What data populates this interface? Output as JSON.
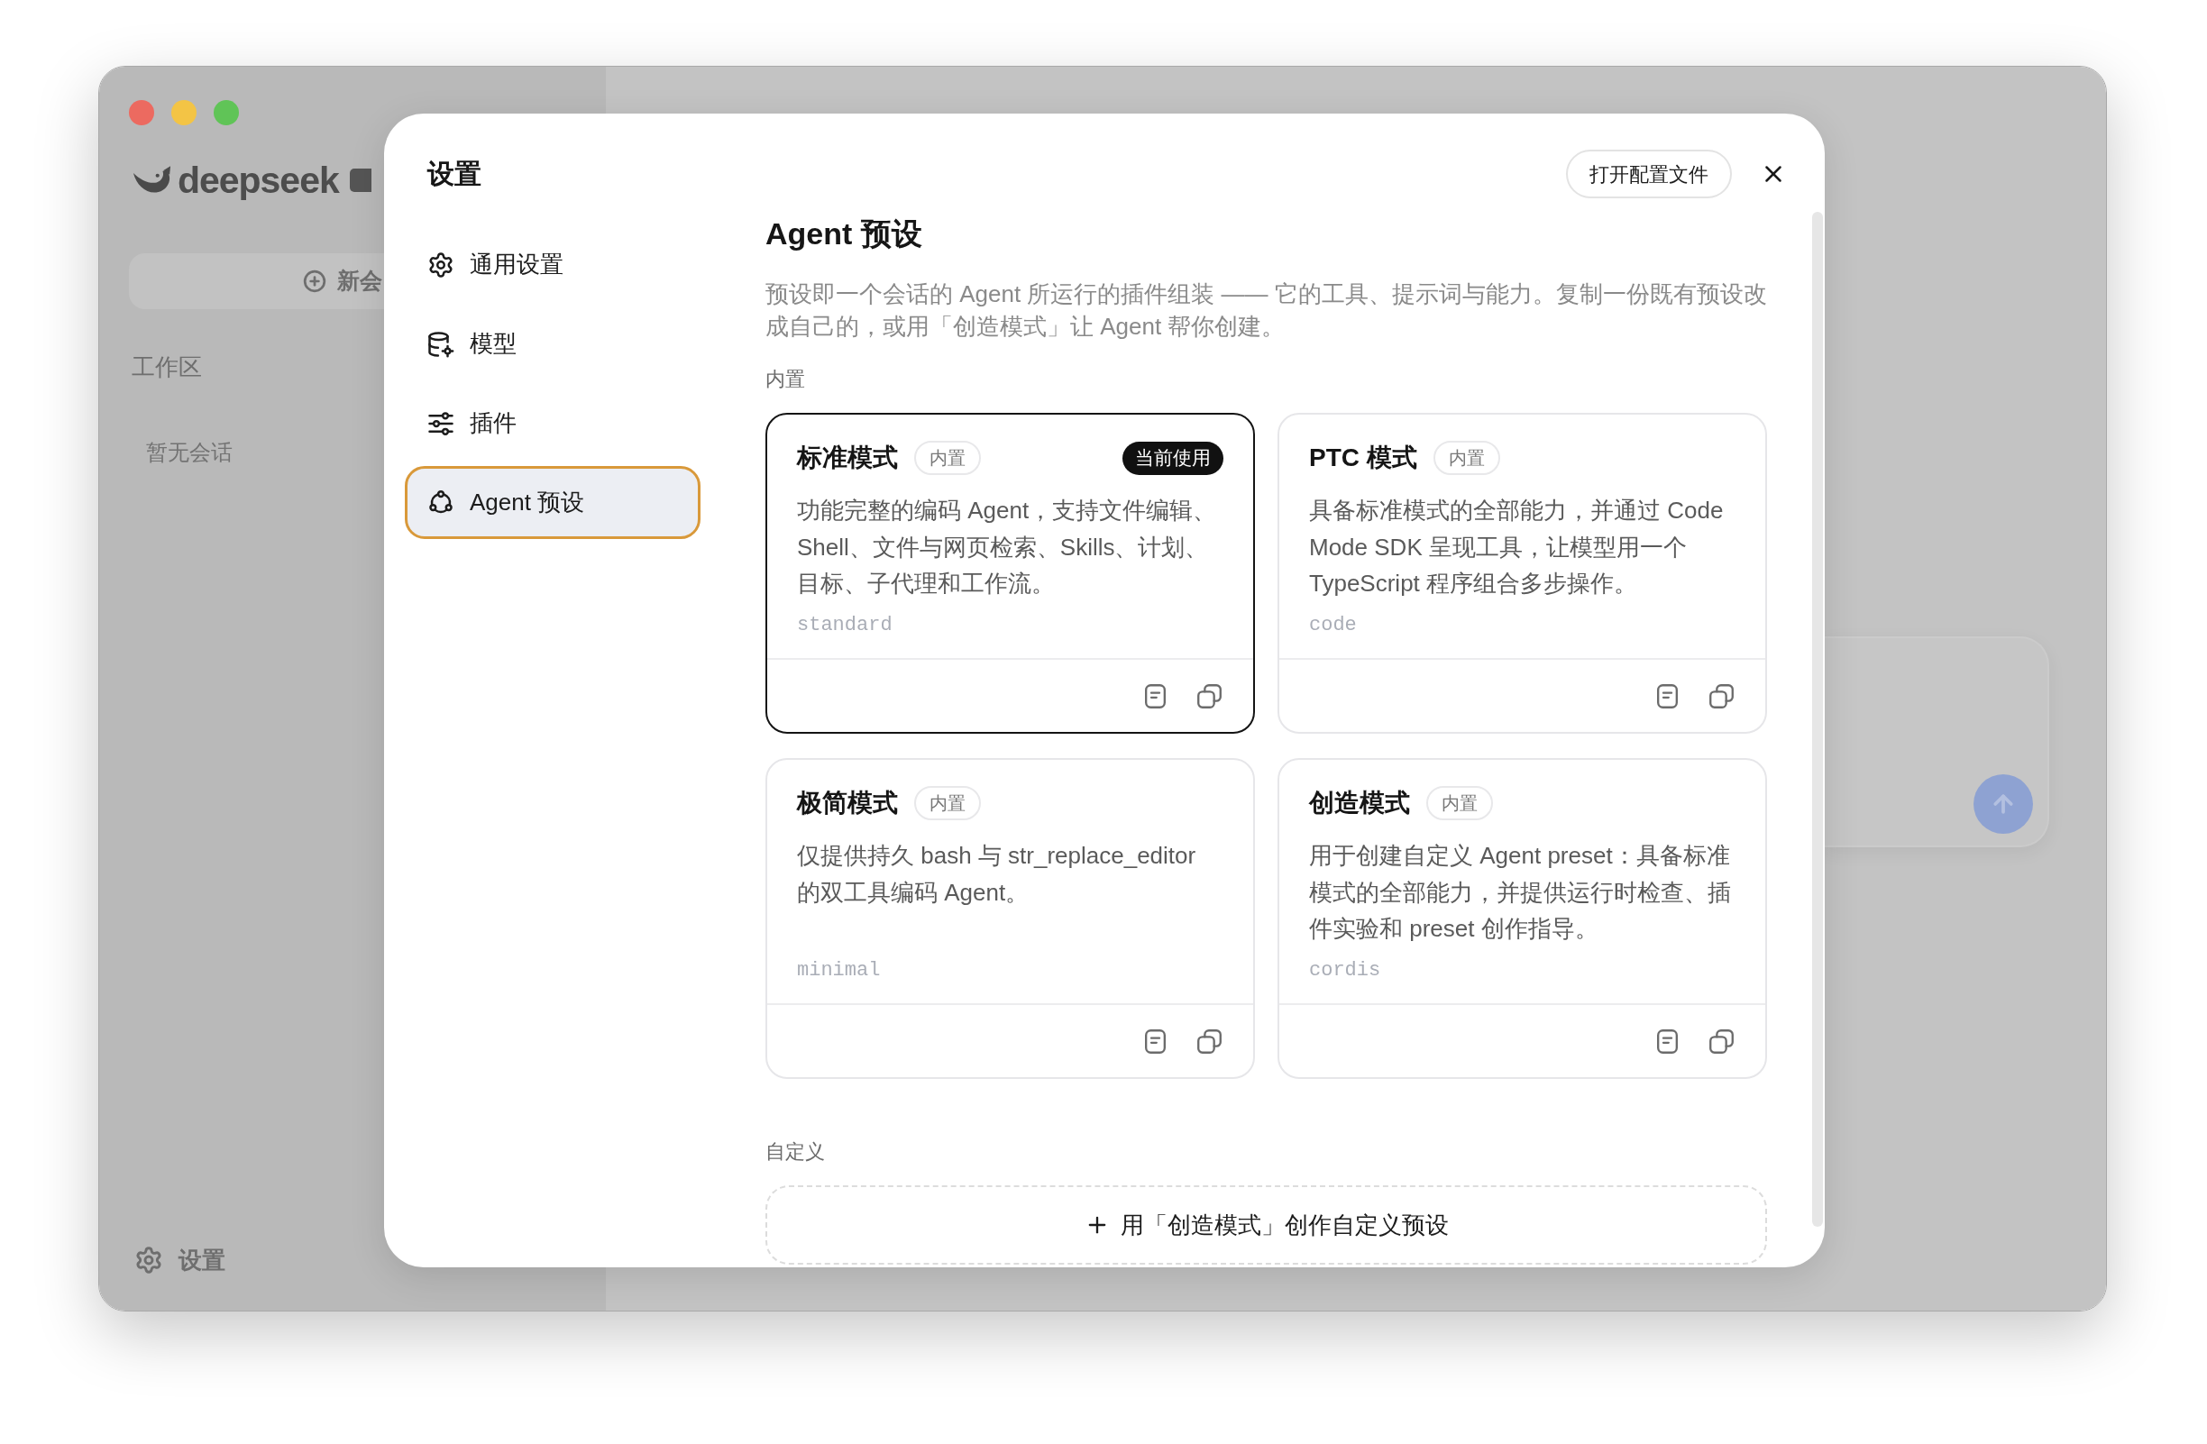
{
  "background_app": {
    "logo_text": "deepseek",
    "new_chat_button": "新会",
    "sidebar_section": "工作区",
    "empty_state": "暂无会话",
    "settings_button": "设置"
  },
  "settings_dialog": {
    "title": "设置",
    "nav_items": [
      {
        "label": "通用设置",
        "selected": false
      },
      {
        "label": "模型",
        "selected": false
      },
      {
        "label": "插件",
        "selected": false
      },
      {
        "label": "Agent 预设",
        "selected": true
      }
    ],
    "open_config_button": "打开配置文件",
    "page": {
      "title": "Agent 预设",
      "description": "预设即一个会话的 Agent 所运行的插件组装 —— 它的工具、提示词与能力。复制一份既有预设改成自己的，或用「创造模式」让 Agent 帮你创建。",
      "sections": [
        {
          "label": "内置",
          "cards": [
            {
              "title": "标准模式",
              "tag": "内置",
              "status": "当前使用",
              "selected": true,
              "description": "功能完整的编码 Agent，支持文件编辑、Shell、文件与网页检索、Skills、计划、目标、子代理和工作流。",
              "id": "standard"
            },
            {
              "title": "PTC 模式",
              "tag": "内置",
              "selected": false,
              "description": "具备标准模式的全部能力，并通过 Code Mode SDK 呈现工具，让模型用一个 TypeScript 程序组合多步操作。",
              "id": "code"
            },
            {
              "title": "极简模式",
              "tag": "内置",
              "selected": false,
              "description": "仅提供持久 bash 与 str_replace_editor 的双工具编码 Agent。",
              "id": "minimal"
            },
            {
              "title": "创造模式",
              "tag": "内置",
              "selected": false,
              "description": "用于创建自定义 Agent preset：具备标准模式的全部能力，并提供运行时检查、插件实验和 preset 创作指导。",
              "id": "cordis"
            }
          ]
        },
        {
          "label": "自定义",
          "add_button": "用「创造模式」创作自定义预设"
        }
      ]
    }
  }
}
